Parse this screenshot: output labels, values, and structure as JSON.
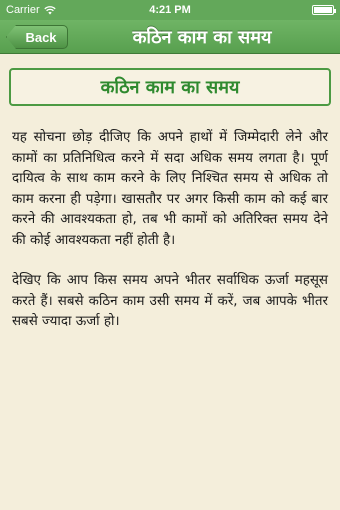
{
  "status_bar": {
    "carrier": "Carrier",
    "time": "4:21 PM",
    "wifi_icon": "wifi-icon",
    "battery_icon": "battery-icon",
    "battery_level": 1.0
  },
  "nav": {
    "back_label": "Back",
    "title": "कठिन काम का समय"
  },
  "article": {
    "heading": "कठिन काम का समय",
    "paragraphs": [
      "यह सोचना छोड़ दीजिए कि अपने हाथों में जिम्मेदारी लेने और कामों का प्रतिनिधित्व करने में सदा अधिक समय लगता है। पूर्ण दायित्व के साथ काम करने के लिए निश्चित समय से अधिक तो काम करना ही पड़ेगा। खासतौर पर अगर किसी काम को कई बार करने की आवश्यकता हो, तब भी कामों को अतिरिक्त समय देने की कोई आवश्यकता नहीं होती है।",
      "देखिए कि आप किस समय अपने भीतर सर्वाधिक ऊर्जा महसूस करते हैं। सबसे कठिन काम उसी समय में करें, जब आपके भीतर सबसे ज्यादा ऊर्जा हो।"
    ]
  },
  "colors": {
    "nav_green": "#63a85a",
    "heading_green": "#2f8a2f",
    "background": "#f4eedb"
  }
}
